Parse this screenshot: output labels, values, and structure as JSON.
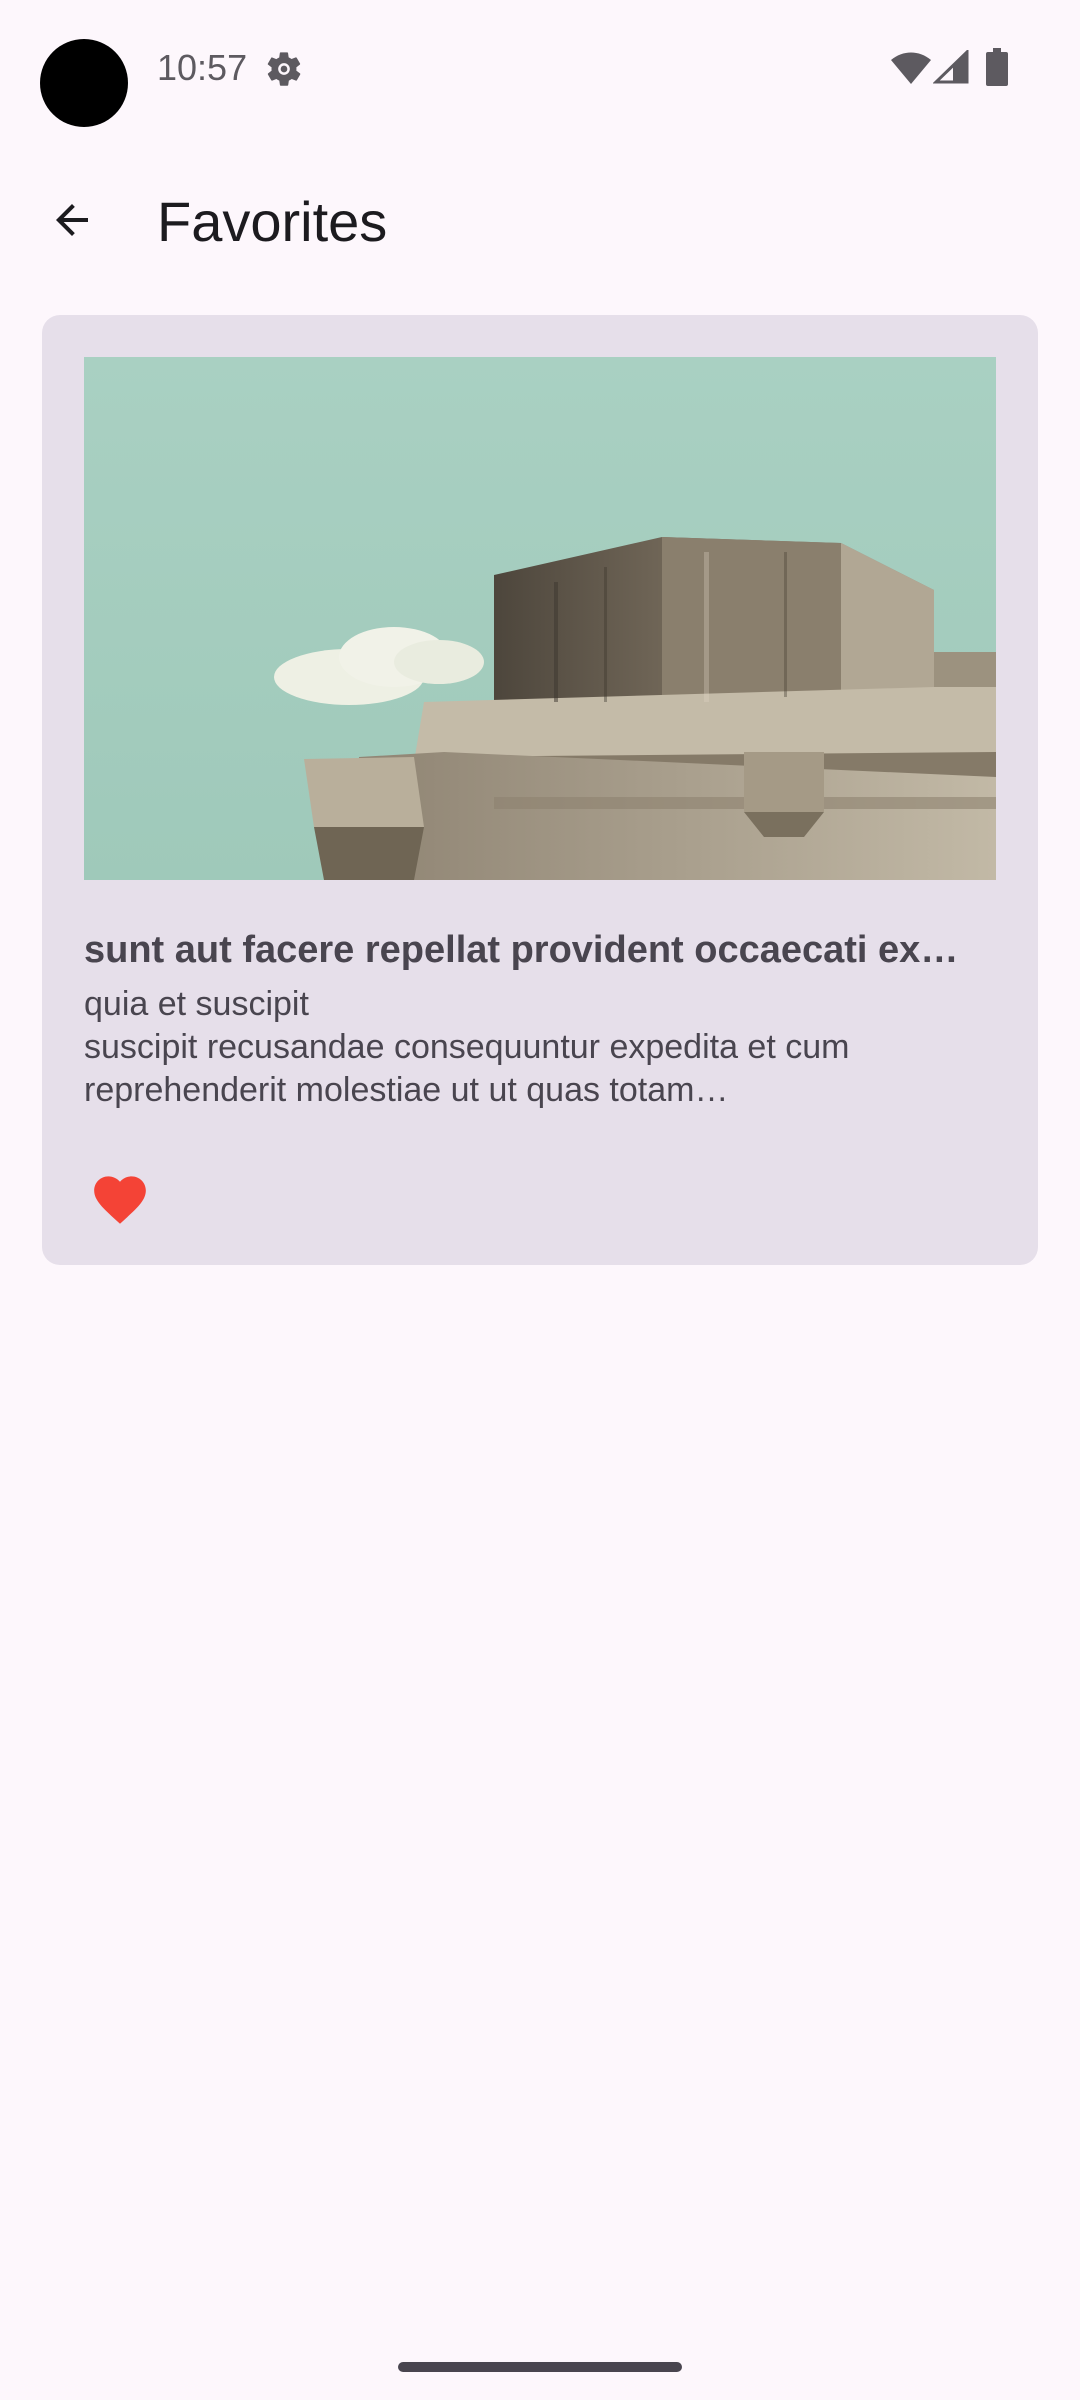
{
  "status_bar": {
    "time": "10:57",
    "icons": [
      "gear-icon",
      "wifi-icon",
      "cell-signal-icon",
      "battery-icon"
    ]
  },
  "app_bar": {
    "back_icon": "arrow-back-icon",
    "title": "Favorites"
  },
  "favorites": [
    {
      "image": "photo of a concrete bunker tower against a pale teal sky",
      "title": "sunt aut facere repellat provident occaecati ex…",
      "body_lines": [
        "quia et suscipit",
        "suscipit recusandae consequuntur expedita et cum",
        "reprehenderit molestiae ut ut quas totam…"
      ],
      "favorite_icon": "heart-icon",
      "favorited": true
    }
  ],
  "colors": {
    "background": "#fdf7fc",
    "card": "#e6dfea",
    "text_primary": "#1c1b1f",
    "text_secondary": "#49454f",
    "heart": "#f44336",
    "sky": "#a7cfc1"
  }
}
